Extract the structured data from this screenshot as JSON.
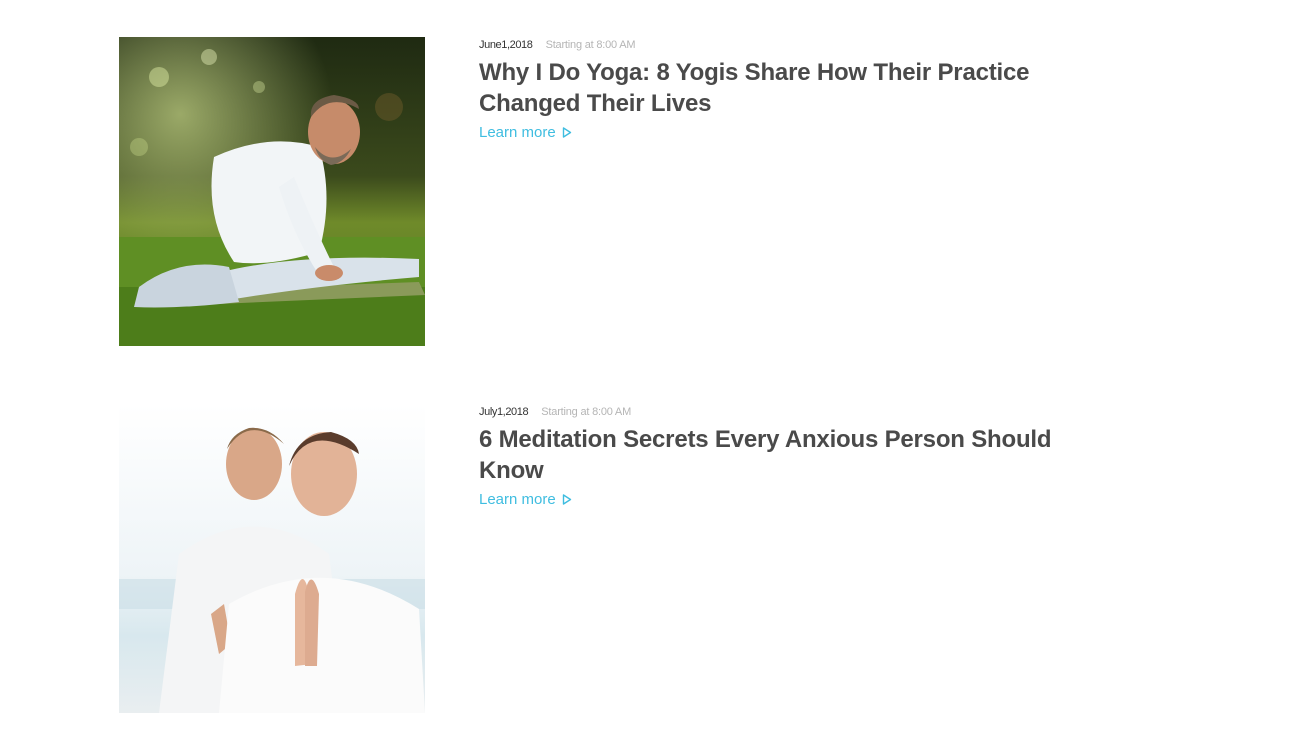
{
  "posts": [
    {
      "date": "June1,2018",
      "time": "Starting at 8:00 AM",
      "title": "Why I Do Yoga: 8 Yogis Share How Their Practice Changed Their Lives",
      "cta": "Learn more",
      "image_icon": "yoga-stretch-photo"
    },
    {
      "date": "July1,2018",
      "time": "Starting at 8:00 AM",
      "title": "6 Meditation Secrets Every Anxious Person Should Know",
      "cta": "Learn more",
      "image_icon": "meditation-couple-photo"
    }
  ],
  "colors": {
    "link": "#3fbde0",
    "title": "#4a4a4a",
    "date": "#333333",
    "time": "#b5b5b5"
  }
}
